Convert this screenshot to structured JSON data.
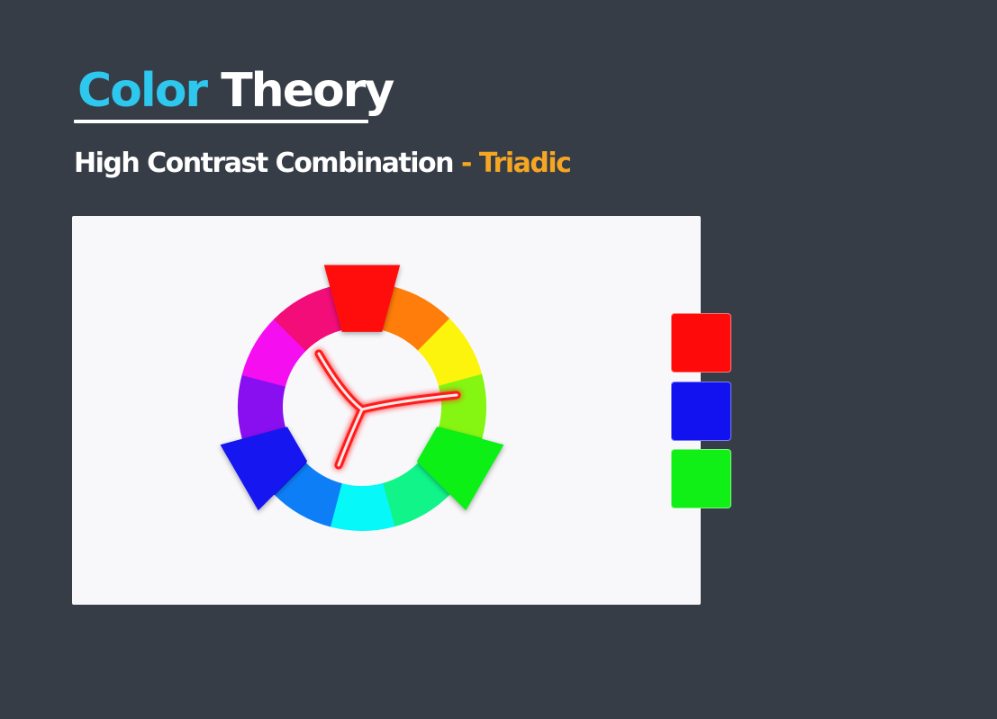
{
  "title": {
    "word1": "Color",
    "word2": "Theory",
    "word1_color": "#2ec7ee",
    "word2_color": "#ffffff"
  },
  "subtitle": {
    "text": "High Contrast Combination",
    "separator": "-",
    "scheme": "Triadic",
    "scheme_color": "#f5a623"
  },
  "color_wheel": {
    "segments": [
      {
        "hue": "red",
        "color": "#ff0a0a",
        "selected": true
      },
      {
        "hue": "red-orange",
        "color": "#ff7d0a",
        "selected": false
      },
      {
        "hue": "yellow",
        "color": "#fcf40d",
        "selected": false
      },
      {
        "hue": "yellow-green",
        "color": "#85f512",
        "selected": false
      },
      {
        "hue": "green",
        "color": "#11f016",
        "selected": true
      },
      {
        "hue": "spring-green",
        "color": "#10f48a",
        "selected": false
      },
      {
        "hue": "cyan",
        "color": "#06f8f8",
        "selected": false
      },
      {
        "hue": "azure",
        "color": "#0e7ef7",
        "selected": false
      },
      {
        "hue": "blue",
        "color": "#1212f0",
        "selected": true
      },
      {
        "hue": "violet",
        "color": "#8a0ff0",
        "selected": false
      },
      {
        "hue": "magenta",
        "color": "#f50ef0",
        "selected": false
      },
      {
        "hue": "rose",
        "color": "#f20d78",
        "selected": false
      }
    ],
    "pointer_color": "#ff1a1a"
  },
  "swatches": [
    {
      "name": "red",
      "color": "#ff0a0a"
    },
    {
      "name": "blue",
      "color": "#1212f0"
    },
    {
      "name": "green",
      "color": "#11f016"
    }
  ]
}
